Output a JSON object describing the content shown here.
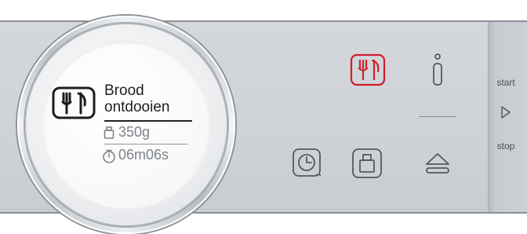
{
  "display": {
    "program_line1": "Brood",
    "program_line2": "ontdooien",
    "weight": "350g",
    "time": "06m06s"
  },
  "start_panel": {
    "start_label": "start",
    "stop_label": "stop"
  },
  "colors": {
    "panel": "#cfd3d8",
    "active_icon": "#d0202a",
    "icon": "#55595e"
  },
  "icons": {
    "display_program": "cutlery-icon",
    "weight": "weight-icon",
    "time": "timer-icon",
    "programs_button": "cutlery-icon",
    "info_button": "info-icon",
    "clock_button": "clock-icon",
    "weight_button": "weight-icon",
    "eject_button": "eject-icon",
    "start": "play-icon"
  }
}
